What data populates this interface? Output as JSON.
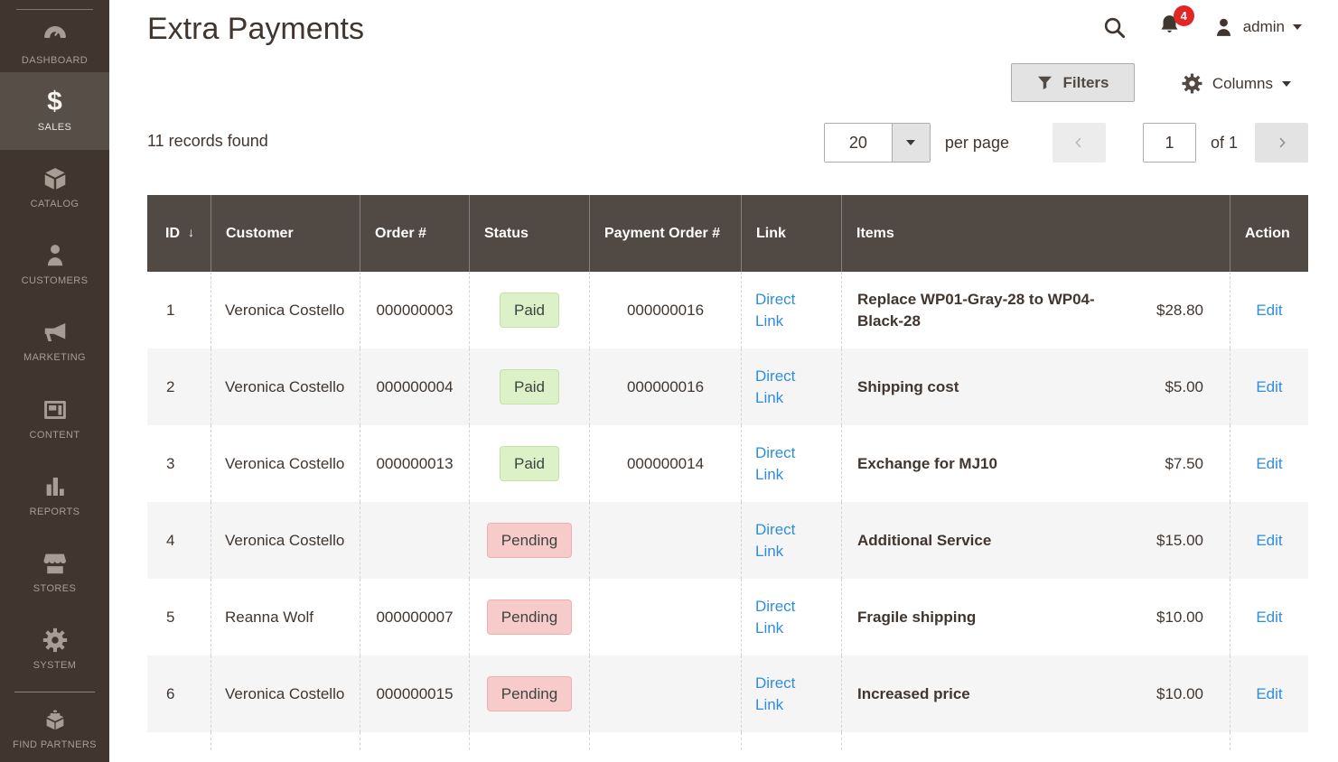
{
  "sidebar": {
    "items": [
      {
        "label": "DASHBOARD",
        "icon": "speedometer"
      },
      {
        "label": "SALES",
        "icon": "dollar",
        "active": true
      },
      {
        "label": "CATALOG",
        "icon": "box"
      },
      {
        "label": "CUSTOMERS",
        "icon": "person"
      },
      {
        "label": "MARKETING",
        "icon": "megaphone"
      },
      {
        "label": "CONTENT",
        "icon": "layout"
      },
      {
        "label": "REPORTS",
        "icon": "bar-chart"
      },
      {
        "label": "STORES",
        "icon": "storefront"
      },
      {
        "label": "SYSTEM",
        "icon": "gear"
      },
      {
        "label": "FIND PARTNERS",
        "icon": "brick"
      }
    ]
  },
  "header": {
    "title": "Extra Payments",
    "notification_count": "4",
    "username": "admin"
  },
  "toolbar": {
    "filters_label": "Filters",
    "columns_label": "Columns"
  },
  "grid_toolbar": {
    "records_text": "11 records found",
    "per_page_value": "20",
    "per_page_label": "per page",
    "page_value": "1",
    "of_label": "of 1"
  },
  "table": {
    "columns": [
      "ID",
      "Customer",
      "Order #",
      "Status",
      "Payment Order #",
      "Link",
      "Items",
      "Action"
    ],
    "sort_indicator": "↓",
    "rows": [
      {
        "id": "1",
        "customer": "Veronica Costello",
        "order": "000000003",
        "status": "Paid",
        "payment_order": "000000016",
        "link": "Direct Link",
        "item": "Replace WP01-Gray-28 to WP04-Black-28",
        "price": "$28.80",
        "action": "Edit"
      },
      {
        "id": "2",
        "customer": "Veronica Costello",
        "order": "000000004",
        "status": "Paid",
        "payment_order": "000000016",
        "link": "Direct Link",
        "item": "Shipping cost",
        "price": "$5.00",
        "action": "Edit"
      },
      {
        "id": "3",
        "customer": "Veronica Costello",
        "order": "000000013",
        "status": "Paid",
        "payment_order": "000000014",
        "link": "Direct Link",
        "item": "Exchange for MJ10",
        "price": "$7.50",
        "action": "Edit"
      },
      {
        "id": "4",
        "customer": "Veronica Costello",
        "order": "",
        "status": "Pending",
        "payment_order": "",
        "link": "Direct Link",
        "item": "Additional Service",
        "price": "$15.00",
        "action": "Edit"
      },
      {
        "id": "5",
        "customer": "Reanna Wolf",
        "order": "000000007",
        "status": "Pending",
        "payment_order": "",
        "link": "Direct Link",
        "item": "Fragile shipping",
        "price": "$10.00",
        "action": "Edit"
      },
      {
        "id": "6",
        "customer": "Veronica Costello",
        "order": "000000015",
        "status": "Pending",
        "payment_order": "",
        "link": "Direct Link",
        "item": "Increased price",
        "price": "$10.00",
        "action": "Edit"
      }
    ]
  },
  "colors": {
    "sidebar_bg": "#41362f",
    "sidebar_active_bg": "#564e47",
    "table_header_bg": "#514943",
    "row_alt_bg": "#f5f5f5",
    "link_blue": "#2e8ede",
    "paid_bg": "#ddf1c9",
    "pending_bg": "#f8cbcb",
    "notification_red": "#e22626",
    "button_gray": "#e3e3e3"
  }
}
